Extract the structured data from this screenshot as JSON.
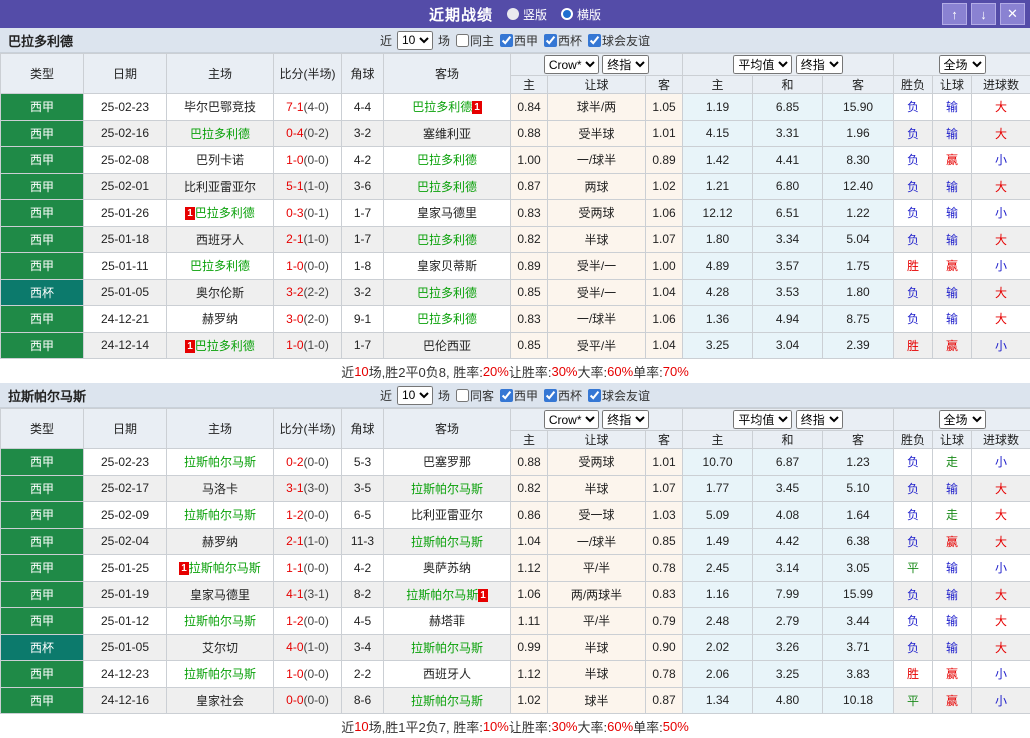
{
  "titlebar": {
    "title": "近期战绩",
    "vertical_label": "竖版",
    "horizontal_label": "横版",
    "up_icon": "↑",
    "down_icon": "↓",
    "close_icon": "✕"
  },
  "colors": {
    "accent_purple": "#544CA8",
    "league_green": "#1F8A47",
    "cup_teal": "#0C7A6C",
    "focus_team_green": "#0AA10A",
    "score_red": "#E60000",
    "loss_blue": "#2222CC"
  },
  "table_head": {
    "type": "类型",
    "date": "日期",
    "home": "主场",
    "score": "比分(半场)",
    "corner": "角球",
    "away": "客场",
    "asia_select": "Crow*",
    "asia_final_select": "终指",
    "euro_select": "平均值",
    "euro_final_select": "终指",
    "scope_select": "全场",
    "sub_home": "主",
    "sub_handicap": "让球",
    "sub_away": "客",
    "sub_ehome": "主",
    "sub_draw": "和",
    "sub_eaway": "客",
    "sub_wl": "胜负",
    "sub_hres": "让球",
    "sub_goals": "进球数"
  },
  "filter_common": {
    "near": "近",
    "count": "10",
    "games": "场",
    "leagues": [
      "西甲",
      "西杯",
      "球会友谊"
    ]
  },
  "result_colors": {
    "胜": "res-red",
    "平": "res-green",
    "负": "res-blue",
    "赢": "res-red",
    "走": "res-green",
    "输": "res-blue",
    "大": "res-red",
    "小": "res-blue"
  },
  "sections": [
    {
      "team": "巴拉多利德",
      "same_label": "同主",
      "same_checked": false,
      "rows": [
        {
          "league": "西甲",
          "cup": false,
          "date": "25-02-23",
          "home": "毕尔巴鄂竞技",
          "home_focus": false,
          "home_badge": "",
          "score": "7-1",
          "half": "(4-0)",
          "corner": "4-4",
          "away": "巴拉多利德",
          "away_focus": true,
          "away_badge": "1",
          "asia": [
            "0.84",
            "球半/两",
            "1.05"
          ],
          "euro": [
            "1.19",
            "6.85",
            "15.90"
          ],
          "results": [
            "负",
            "输",
            "大"
          ]
        },
        {
          "league": "西甲",
          "cup": false,
          "date": "25-02-16",
          "home": "巴拉多利德",
          "home_focus": true,
          "home_badge": "",
          "score": "0-4",
          "half": "(0-2)",
          "corner": "3-2",
          "away": "塞维利亚",
          "away_focus": false,
          "away_badge": "",
          "asia": [
            "0.88",
            "受半球",
            "1.01"
          ],
          "euro": [
            "4.15",
            "3.31",
            "1.96"
          ],
          "results": [
            "负",
            "输",
            "大"
          ]
        },
        {
          "league": "西甲",
          "cup": false,
          "date": "25-02-08",
          "home": "巴列卡诺",
          "home_focus": false,
          "home_badge": "",
          "score": "1-0",
          "half": "(0-0)",
          "corner": "4-2",
          "away": "巴拉多利德",
          "away_focus": true,
          "away_badge": "",
          "asia": [
            "1.00",
            "一/球半",
            "0.89"
          ],
          "euro": [
            "1.42",
            "4.41",
            "8.30"
          ],
          "results": [
            "负",
            "赢",
            "小"
          ]
        },
        {
          "league": "西甲",
          "cup": false,
          "date": "25-02-01",
          "home": "比利亚雷亚尔",
          "home_focus": false,
          "home_badge": "",
          "score": "5-1",
          "half": "(1-0)",
          "corner": "3-6",
          "away": "巴拉多利德",
          "away_focus": true,
          "away_badge": "",
          "asia": [
            "0.87",
            "两球",
            "1.02"
          ],
          "euro": [
            "1.21",
            "6.80",
            "12.40"
          ],
          "results": [
            "负",
            "输",
            "大"
          ]
        },
        {
          "league": "西甲",
          "cup": false,
          "date": "25-01-26",
          "home": "巴拉多利德",
          "home_focus": true,
          "home_badge": "1",
          "score": "0-3",
          "half": "(0-1)",
          "corner": "1-7",
          "away": "皇家马德里",
          "away_focus": false,
          "away_badge": "",
          "asia": [
            "0.83",
            "受两球",
            "1.06"
          ],
          "euro": [
            "12.12",
            "6.51",
            "1.22"
          ],
          "results": [
            "负",
            "输",
            "小"
          ]
        },
        {
          "league": "西甲",
          "cup": false,
          "date": "25-01-18",
          "home": "西班牙人",
          "home_focus": false,
          "home_badge": "",
          "score": "2-1",
          "half": "(1-0)",
          "corner": "1-7",
          "away": "巴拉多利德",
          "away_focus": true,
          "away_badge": "",
          "asia": [
            "0.82",
            "半球",
            "1.07"
          ],
          "euro": [
            "1.80",
            "3.34",
            "5.04"
          ],
          "results": [
            "负",
            "输",
            "大"
          ]
        },
        {
          "league": "西甲",
          "cup": false,
          "date": "25-01-11",
          "home": "巴拉多利德",
          "home_focus": true,
          "home_badge": "",
          "score": "1-0",
          "half": "(0-0)",
          "corner": "1-8",
          "away": "皇家贝蒂斯",
          "away_focus": false,
          "away_badge": "",
          "asia": [
            "0.89",
            "受半/一",
            "1.00"
          ],
          "euro": [
            "4.89",
            "3.57",
            "1.75"
          ],
          "results": [
            "胜",
            "赢",
            "小"
          ]
        },
        {
          "league": "西杯",
          "cup": true,
          "date": "25-01-05",
          "home": "奥尔伦斯",
          "home_focus": false,
          "home_badge": "",
          "score": "3-2",
          "half": "(2-2)",
          "corner": "3-2",
          "away": "巴拉多利德",
          "away_focus": true,
          "away_badge": "",
          "asia": [
            "0.85",
            "受半/一",
            "1.04"
          ],
          "euro": [
            "4.28",
            "3.53",
            "1.80"
          ],
          "results": [
            "负",
            "输",
            "大"
          ]
        },
        {
          "league": "西甲",
          "cup": false,
          "date": "24-12-21",
          "home": "赫罗纳",
          "home_focus": false,
          "home_badge": "",
          "score": "3-0",
          "half": "(2-0)",
          "corner": "9-1",
          "away": "巴拉多利德",
          "away_focus": true,
          "away_badge": "",
          "asia": [
            "0.83",
            "一/球半",
            "1.06"
          ],
          "euro": [
            "1.36",
            "4.94",
            "8.75"
          ],
          "results": [
            "负",
            "输",
            "大"
          ]
        },
        {
          "league": "西甲",
          "cup": false,
          "date": "24-12-14",
          "home": "巴拉多利德",
          "home_focus": true,
          "home_badge": "1",
          "score": "1-0",
          "half": "(1-0)",
          "corner": "1-7",
          "away": "巴伦西亚",
          "away_focus": false,
          "away_badge": "",
          "asia": [
            "0.85",
            "受平/半",
            "1.04"
          ],
          "euro": [
            "3.25",
            "3.04",
            "2.39"
          ],
          "results": [
            "胜",
            "赢",
            "小"
          ]
        }
      ],
      "summary_parts": [
        {
          "t": "近"
        },
        {
          "t": "10",
          "red": true
        },
        {
          "t": "场,胜2平0负8, 胜率:"
        },
        {
          "t": "20%",
          "red": true
        },
        {
          "t": " 让胜率:"
        },
        {
          "t": "30%",
          "red": true
        },
        {
          "t": " 大率:"
        },
        {
          "t": "60%",
          "red": true
        },
        {
          "t": " 单率:"
        },
        {
          "t": "70%",
          "red": true
        }
      ]
    },
    {
      "team": "拉斯帕尔马斯",
      "same_label": "同客",
      "same_checked": false,
      "rows": [
        {
          "league": "西甲",
          "cup": false,
          "date": "25-02-23",
          "home": "拉斯帕尔马斯",
          "home_focus": true,
          "home_badge": "",
          "score": "0-2",
          "half": "(0-0)",
          "corner": "5-3",
          "away": "巴塞罗那",
          "away_focus": false,
          "away_badge": "",
          "asia": [
            "0.88",
            "受两球",
            "1.01"
          ],
          "euro": [
            "10.70",
            "6.87",
            "1.23"
          ],
          "results": [
            "负",
            "走",
            "小"
          ]
        },
        {
          "league": "西甲",
          "cup": false,
          "date": "25-02-17",
          "home": "马洛卡",
          "home_focus": false,
          "home_badge": "",
          "score": "3-1",
          "half": "(3-0)",
          "corner": "3-5",
          "away": "拉斯帕尔马斯",
          "away_focus": true,
          "away_badge": "",
          "asia": [
            "0.82",
            "半球",
            "1.07"
          ],
          "euro": [
            "1.77",
            "3.45",
            "5.10"
          ],
          "results": [
            "负",
            "输",
            "大"
          ]
        },
        {
          "league": "西甲",
          "cup": false,
          "date": "25-02-09",
          "home": "拉斯帕尔马斯",
          "home_focus": true,
          "home_badge": "",
          "score": "1-2",
          "half": "(0-0)",
          "corner": "6-5",
          "away": "比利亚雷亚尔",
          "away_focus": false,
          "away_badge": "",
          "asia": [
            "0.86",
            "受一球",
            "1.03"
          ],
          "euro": [
            "5.09",
            "4.08",
            "1.64"
          ],
          "results": [
            "负",
            "走",
            "大"
          ]
        },
        {
          "league": "西甲",
          "cup": false,
          "date": "25-02-04",
          "home": "赫罗纳",
          "home_focus": false,
          "home_badge": "",
          "score": "2-1",
          "half": "(1-0)",
          "corner": "11-3",
          "away": "拉斯帕尔马斯",
          "away_focus": true,
          "away_badge": "",
          "asia": [
            "1.04",
            "一/球半",
            "0.85"
          ],
          "euro": [
            "1.49",
            "4.42",
            "6.38"
          ],
          "results": [
            "负",
            "赢",
            "大"
          ]
        },
        {
          "league": "西甲",
          "cup": false,
          "date": "25-01-25",
          "home": "拉斯帕尔马斯",
          "home_focus": true,
          "home_badge": "1",
          "score": "1-1",
          "half": "(0-0)",
          "corner": "4-2",
          "away": "奥萨苏纳",
          "away_focus": false,
          "away_badge": "",
          "asia": [
            "1.12",
            "平/半",
            "0.78"
          ],
          "euro": [
            "2.45",
            "3.14",
            "3.05"
          ],
          "results": [
            "平",
            "输",
            "小"
          ]
        },
        {
          "league": "西甲",
          "cup": false,
          "date": "25-01-19",
          "home": "皇家马德里",
          "home_focus": false,
          "home_badge": "",
          "score": "4-1",
          "half": "(3-1)",
          "corner": "8-2",
          "away": "拉斯帕尔马斯",
          "away_focus": true,
          "away_badge": "1",
          "asia": [
            "1.06",
            "两/两球半",
            "0.83"
          ],
          "euro": [
            "1.16",
            "7.99",
            "15.99"
          ],
          "results": [
            "负",
            "输",
            "大"
          ]
        },
        {
          "league": "西甲",
          "cup": false,
          "date": "25-01-12",
          "home": "拉斯帕尔马斯",
          "home_focus": true,
          "home_badge": "",
          "score": "1-2",
          "half": "(0-0)",
          "corner": "4-5",
          "away": "赫塔菲",
          "away_focus": false,
          "away_badge": "",
          "asia": [
            "1.11",
            "平/半",
            "0.79"
          ],
          "euro": [
            "2.48",
            "2.79",
            "3.44"
          ],
          "results": [
            "负",
            "输",
            "大"
          ]
        },
        {
          "league": "西杯",
          "cup": true,
          "date": "25-01-05",
          "home": "艾尔切",
          "home_focus": false,
          "home_badge": "",
          "score": "4-0",
          "half": "(1-0)",
          "corner": "3-4",
          "away": "拉斯帕尔马斯",
          "away_focus": true,
          "away_badge": "",
          "asia": [
            "0.99",
            "半球",
            "0.90"
          ],
          "euro": [
            "2.02",
            "3.26",
            "3.71"
          ],
          "results": [
            "负",
            "输",
            "大"
          ]
        },
        {
          "league": "西甲",
          "cup": false,
          "date": "24-12-23",
          "home": "拉斯帕尔马斯",
          "home_focus": true,
          "home_badge": "",
          "score": "1-0",
          "half": "(0-0)",
          "corner": "2-2",
          "away": "西班牙人",
          "away_focus": false,
          "away_badge": "",
          "asia": [
            "1.12",
            "半球",
            "0.78"
          ],
          "euro": [
            "2.06",
            "3.25",
            "3.83"
          ],
          "results": [
            "胜",
            "赢",
            "小"
          ]
        },
        {
          "league": "西甲",
          "cup": false,
          "date": "24-12-16",
          "home": "皇家社会",
          "home_focus": false,
          "home_badge": "",
          "score": "0-0",
          "half": "(0-0)",
          "corner": "8-6",
          "away": "拉斯帕尔马斯",
          "away_focus": true,
          "away_badge": "",
          "asia": [
            "1.02",
            "球半",
            "0.87"
          ],
          "euro": [
            "1.34",
            "4.80",
            "10.18"
          ],
          "results": [
            "平",
            "赢",
            "小"
          ]
        }
      ],
      "summary_parts": [
        {
          "t": "近"
        },
        {
          "t": "10",
          "red": true
        },
        {
          "t": "场,胜1平2负7, 胜率:"
        },
        {
          "t": "10%",
          "red": true
        },
        {
          "t": " 让胜率:"
        },
        {
          "t": "30%",
          "red": true
        },
        {
          "t": " 大率:"
        },
        {
          "t": "60%",
          "red": true
        },
        {
          "t": " 单率:"
        },
        {
          "t": "50%",
          "red": true
        }
      ]
    }
  ]
}
